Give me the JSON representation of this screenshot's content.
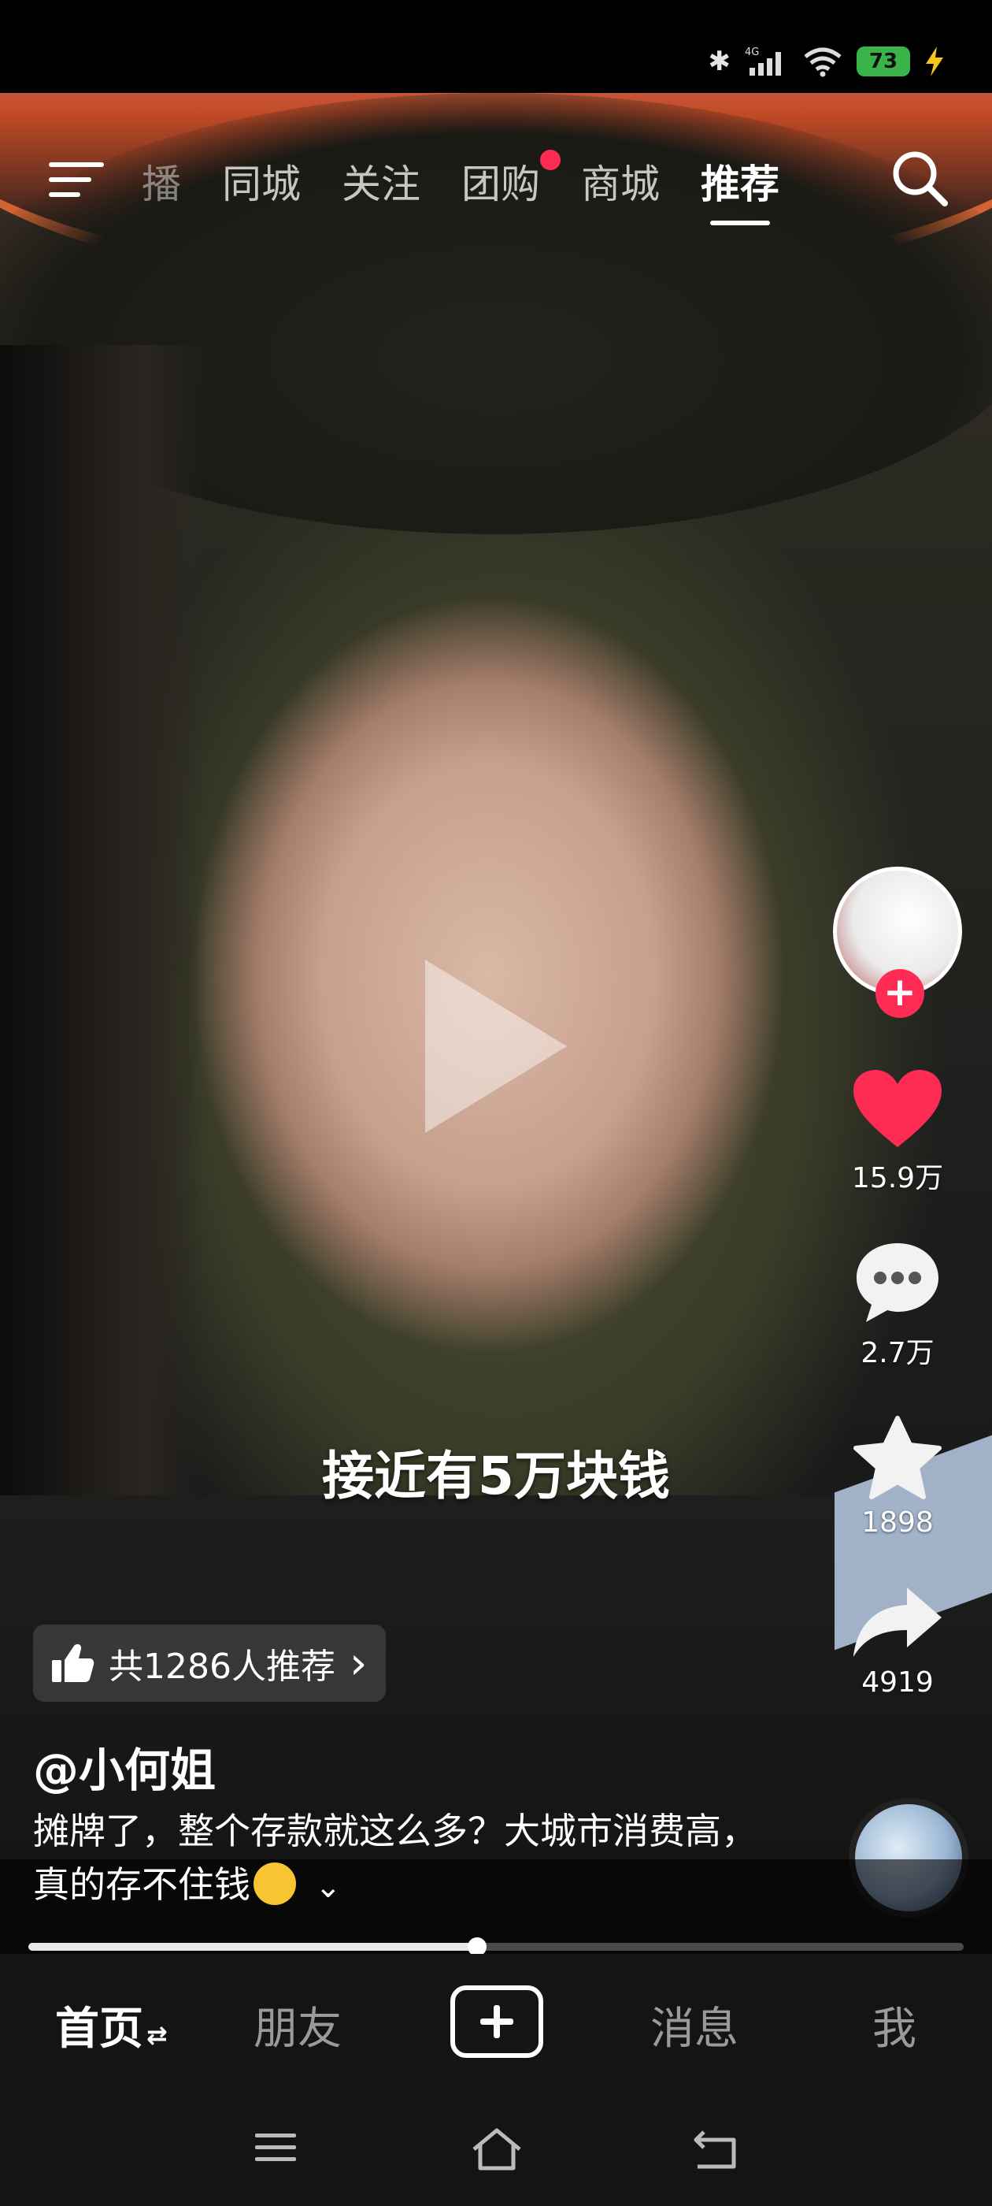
{
  "status_bar": {
    "network": "4G",
    "battery": "73"
  },
  "top_nav": {
    "tabs": [
      {
        "label": "播",
        "state": "partial"
      },
      {
        "label": "同城",
        "state": "normal"
      },
      {
        "label": "关注",
        "state": "normal"
      },
      {
        "label": "团购",
        "state": "normal",
        "badge": true
      },
      {
        "label": "商城",
        "state": "normal"
      },
      {
        "label": "推荐",
        "state": "active"
      }
    ],
    "icons": [
      "menu-icon",
      "search-icon"
    ]
  },
  "video": {
    "subtitle": "接近有5万块钱",
    "paused": true
  },
  "actions": {
    "likes": "15.9万",
    "comments": "2.7万",
    "favorites": "1898",
    "shares": "4919",
    "follow_symbol": "+"
  },
  "recommend_chip": {
    "label": "共1286人推荐",
    "chevron": "›"
  },
  "post": {
    "author": "@小何姐",
    "description": "摊牌了，整个存款就这么多？大城市消费高，真的存不住钱"
  },
  "progress": {
    "fraction": 0.48
  },
  "bottom_nav": {
    "home": "首页",
    "friends": "朋友",
    "messages": "消息",
    "me": "我"
  },
  "colors": {
    "accent": "#fe2c55",
    "battery": "#3ab34a"
  }
}
